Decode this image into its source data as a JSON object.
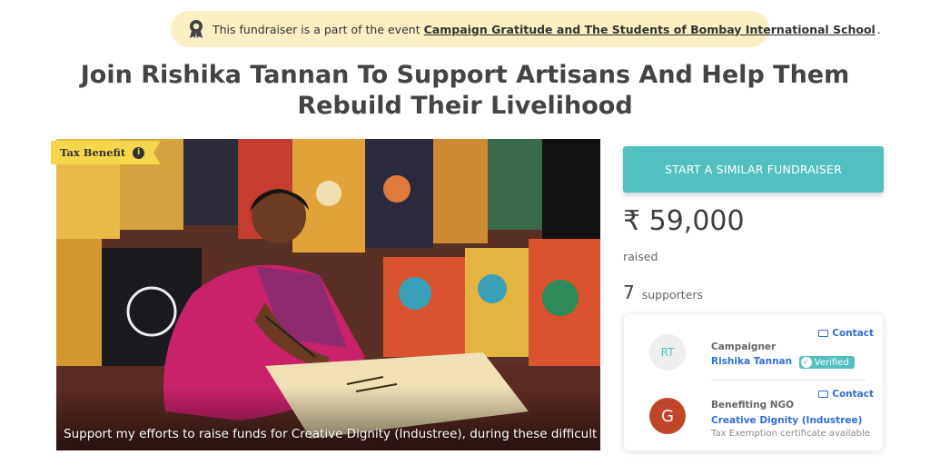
{
  "event_banner": {
    "prefix": "This fundraiser is a part of the event",
    "event_link": "Campaign Gratitude and The Students of Bombay International School",
    "suffix": ".",
    "icon": "award-icon"
  },
  "title": "Join Rishika Tannan To Support Artisans And Help Them Rebuild Their Livelihood",
  "hero": {
    "badge": "Tax Benefit",
    "badge_icon": "info-icon",
    "caption": "Support my efforts to raise funds for Creative Dignity (Industree), during these difficult times"
  },
  "sidebar": {
    "cta_label": "START A SIMILAR FUNDRAISER",
    "amount": "₹ 59,000",
    "raised_label": "raised",
    "supporters_count": "7",
    "supporters_label": "supporters"
  },
  "people": {
    "campaigner": {
      "initials": "RT",
      "role": "Campaigner",
      "name": "Rishika Tannan",
      "verified_label": "Verified",
      "contact_label": "Contact"
    },
    "ngo": {
      "initial": "G",
      "role": "Benefiting NGO",
      "name": "Creative Dignity (Industree)",
      "note": "Tax Exemption certificate available",
      "contact_label": "Contact"
    }
  },
  "colors": {
    "accent": "#52c0bf",
    "banner_bg": "#faf0c4",
    "badge_bg": "#f6d64a",
    "link": "#2f6fd8",
    "ngo_avatar": "#c0462a"
  }
}
